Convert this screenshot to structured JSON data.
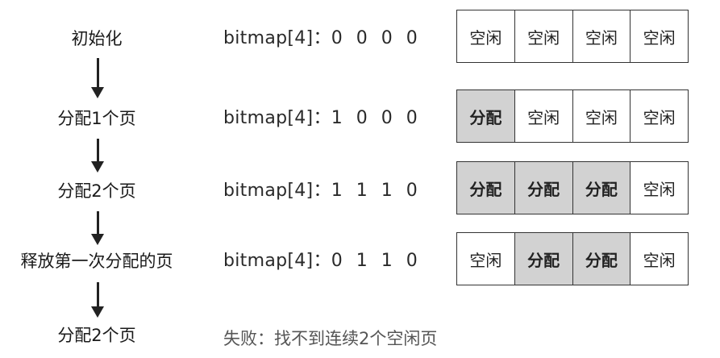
{
  "steps": [
    {
      "label": "初始化",
      "bitmap_prefix": "bitmap[4]：",
      "bits": "0 0 0 0",
      "cells": [
        "空闲",
        "空闲",
        "空闲",
        "空闲"
      ],
      "alloc": [
        false,
        false,
        false,
        false
      ]
    },
    {
      "label": "分配1个页",
      "bitmap_prefix": "bitmap[4]：",
      "bits": "1 0 0 0",
      "cells": [
        "分配",
        "空闲",
        "空闲",
        "空闲"
      ],
      "alloc": [
        true,
        false,
        false,
        false
      ]
    },
    {
      "label": "分配2个页",
      "bitmap_prefix": "bitmap[4]：",
      "bits": "1 1 1 0",
      "cells": [
        "分配",
        "分配",
        "分配",
        "空闲"
      ],
      "alloc": [
        true,
        true,
        true,
        false
      ]
    },
    {
      "label": "释放第一次分配的页",
      "bitmap_prefix": "bitmap[4]：",
      "bits": "0 1 1 0",
      "cells": [
        "空闲",
        "分配",
        "分配",
        "空闲"
      ],
      "alloc": [
        false,
        true,
        true,
        false
      ]
    }
  ],
  "final_step": {
    "label": "分配2个页",
    "result": "失败：找不到连续2个空闲页"
  }
}
